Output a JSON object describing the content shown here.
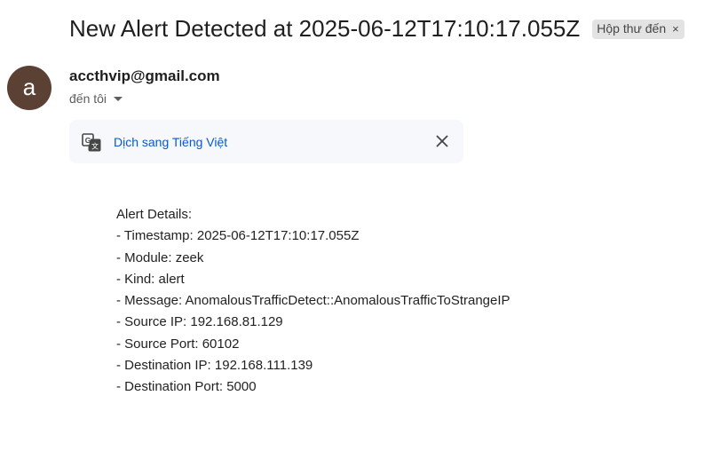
{
  "email": {
    "subject": "New Alert Detected at 2025-06-12T17:10:17.055Z",
    "label": "Hộp thư đến",
    "label_remove": "×",
    "sender_initial": "a",
    "sender": "accthvip@gmail.com",
    "recipient": "đến tôi",
    "translate": {
      "link": "Dịch sang Tiếng Việt"
    },
    "body_lines": [
      "Alert Details:",
      "- Timestamp: 2025-06-12T17:10:17.055Z",
      "- Module: zeek",
      "- Kind: alert",
      "- Message: AnomalousTrafficDetect::AnomalousTrafficToStrangeIP",
      "- Source IP: 192.168.81.129",
      "- Source Port: 60102",
      "- Destination IP: 192.168.111.139",
      "- Destination Port: 5000"
    ]
  },
  "icons": {
    "translate": "translate-icon",
    "close": "close-icon",
    "dropdown": "caret-down-icon"
  },
  "colors": {
    "avatar_bg": "#5b4034",
    "link": "#0b57d0",
    "chip_bg": "#e3e3e3",
    "translate_bar_bg": "#f6f8fc"
  }
}
